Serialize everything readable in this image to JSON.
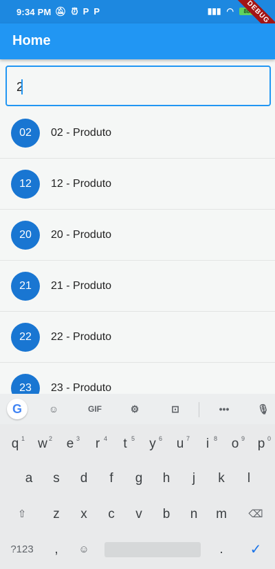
{
  "status_bar": {
    "time": "9:34 PM",
    "left_icons": [
      "mute-icon",
      "alarm-icon",
      "parking-icon",
      "parking-icon"
    ],
    "battery": "88",
    "debug_label": "DEBUG"
  },
  "app_bar": {
    "title": "Home"
  },
  "search": {
    "value": "2"
  },
  "list": {
    "items": [
      {
        "avatar": "02",
        "label": "02 - Produto"
      },
      {
        "avatar": "12",
        "label": "12 - Produto"
      },
      {
        "avatar": "20",
        "label": "20 - Produto"
      },
      {
        "avatar": "21",
        "label": "21 - Produto"
      },
      {
        "avatar": "22",
        "label": "22 - Produto"
      },
      {
        "avatar": "23",
        "label": "23 - Produto"
      }
    ]
  },
  "keyboard": {
    "toolbar": {
      "google": "G",
      "gif": "GIF",
      "more": "•••"
    },
    "row1": [
      {
        "k": "q",
        "n": "1"
      },
      {
        "k": "w",
        "n": "2"
      },
      {
        "k": "e",
        "n": "3"
      },
      {
        "k": "r",
        "n": "4"
      },
      {
        "k": "t",
        "n": "5"
      },
      {
        "k": "y",
        "n": "6"
      },
      {
        "k": "u",
        "n": "7"
      },
      {
        "k": "i",
        "n": "8"
      },
      {
        "k": "o",
        "n": "9"
      },
      {
        "k": "p",
        "n": "0"
      }
    ],
    "row2": [
      "a",
      "s",
      "d",
      "f",
      "g",
      "h",
      "j",
      "k",
      "l"
    ],
    "row3": [
      "z",
      "x",
      "c",
      "v",
      "b",
      "n",
      "m"
    ],
    "symbols_label": "?123",
    "comma": ",",
    "period": "."
  },
  "colors": {
    "primary": "#2196f3",
    "status_bar": "#1d88e0",
    "avatar": "#1976d2",
    "debug": "#a31515"
  }
}
